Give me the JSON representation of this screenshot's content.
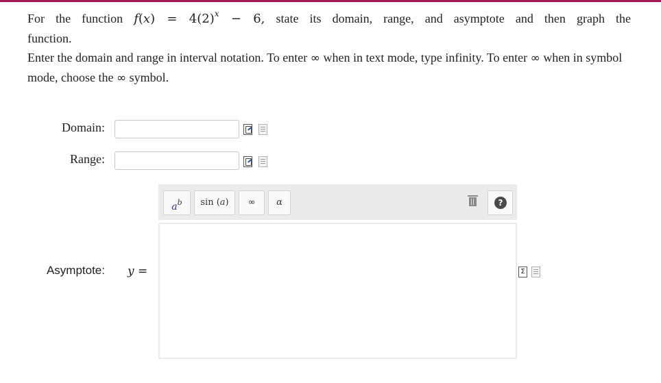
{
  "question": {
    "for_the_function": "For the function",
    "f": "f",
    "lparen": "(",
    "x": "x",
    "rparen": ")",
    "eq": " = ",
    "base": "4(2)",
    "exp": "x",
    "minus6": " − 6,",
    "after_formula": "state its domain, range, and asymptote and then graph the",
    "line2": "function.",
    "instr_a": "Enter the domain and range in interval notation. To enter",
    "instr_b": "when in text mode, type infinity. To enter",
    "instr_c": "when in symbol mode, choose the",
    "instr_d": "symbol.",
    "infinity_symbol": "∞"
  },
  "domain": {
    "label": "Domain:",
    "value": ""
  },
  "range": {
    "label": "Range:",
    "value": ""
  },
  "asymptote": {
    "label": "Asymptote:",
    "y_var": "y",
    "eq": " =",
    "value": ""
  },
  "toolbar": {
    "pow_a": "a",
    "pow_b": "b",
    "sin_fn": "sin ",
    "sin_arg": "a",
    "infinity": "∞",
    "alpha": "α",
    "help": "?"
  },
  "icons": {
    "edit": "equation-editor-icon",
    "preview": "preview-icon",
    "sigma": "sigma-editor-icon",
    "trash": "trash-icon",
    "help": "help-icon"
  },
  "colors": {
    "accent_bar": "#a4194f",
    "toolbar_bg": "#ebebeb"
  }
}
